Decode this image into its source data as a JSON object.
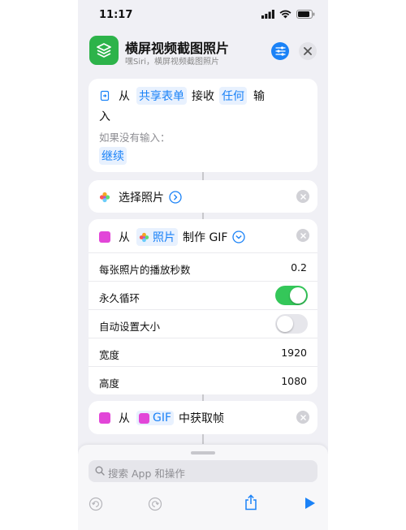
{
  "status": {
    "time": "11:17"
  },
  "header": {
    "title": "横屏视频截图照片",
    "subtitle": "嘿Siri，横屏视频截图照片"
  },
  "card1": {
    "from": "从",
    "source": "共享表单",
    "receive": "接收",
    "any": "任何",
    "input_a": "输",
    "input_b": "入",
    "if_none": "如果没有输入：",
    "continue": "继续"
  },
  "card2": {
    "label": "选择照片"
  },
  "card3": {
    "from": "从",
    "photos": "照片",
    "make": "制作 GIF",
    "settings": [
      {
        "label": "每张照片的播放秒数",
        "value": "0.2"
      },
      {
        "label": "永久循环",
        "toggle": true
      },
      {
        "label": "自动设置大小",
        "toggle": false
      },
      {
        "label": "宽度",
        "value": "1920"
      },
      {
        "label": "高度",
        "value": "1080"
      }
    ]
  },
  "card4": {
    "from": "从",
    "gif": "GIF",
    "action": "中获取帧"
  },
  "search": {
    "placeholder": "搜索 App 和操作"
  },
  "colors": {
    "accent": "#1a82f7",
    "toggle_on": "#34c759",
    "app_icon": "#2db34a",
    "gif_icon": "#e246d8"
  }
}
